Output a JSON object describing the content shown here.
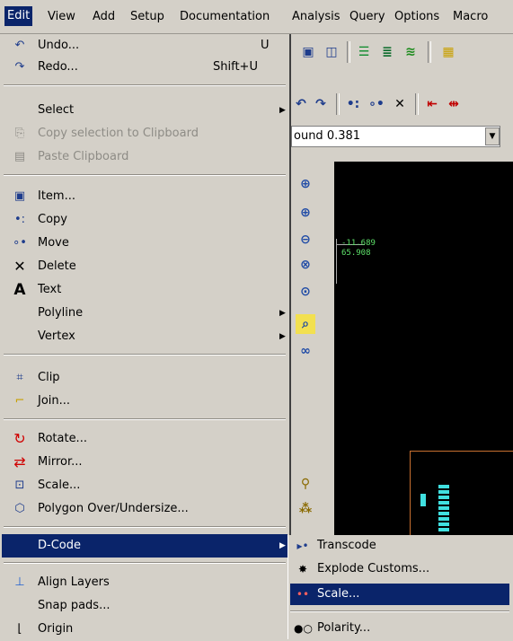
{
  "menubar": {
    "items": [
      "Edit",
      "View",
      "Add",
      "Setup",
      "Documentation",
      "Analysis",
      "Query",
      "Options",
      "Macro"
    ]
  },
  "combo": {
    "value": "ound 0.381"
  },
  "canvas": {
    "coord_x": "-11.689",
    "coord_y": "65.908"
  },
  "edit_menu": {
    "undo": {
      "label": "Undo...",
      "shortcut": "U"
    },
    "redo": {
      "label": "Redo...",
      "shortcut": "Shift+U"
    },
    "select": "Select",
    "copy_selection": "Copy selection to Clipboard",
    "paste_clipboard": "Paste Clipboard",
    "item": "Item...",
    "copy": "Copy",
    "move": "Move",
    "delete": "Delete",
    "text": "Text",
    "polyline": "Polyline",
    "vertex": "Vertex",
    "clip": "Clip",
    "join": "Join...",
    "rotate": "Rotate...",
    "mirror": "Mirror...",
    "scale": "Scale...",
    "polygon": "Polygon Over/Undersize...",
    "dcode": "D-Code",
    "align_layers": "Align Layers",
    "snap_pads": "Snap pads...",
    "origin": "Origin"
  },
  "dcode_submenu": {
    "transcode": "Transcode",
    "explode": "Explode Customs...",
    "scale": "Scale...",
    "polarity": "Polarity..."
  },
  "colors": {
    "highlight": "#0a246a",
    "menu_bg": "#d4d0c8",
    "canvas": "#000000"
  }
}
